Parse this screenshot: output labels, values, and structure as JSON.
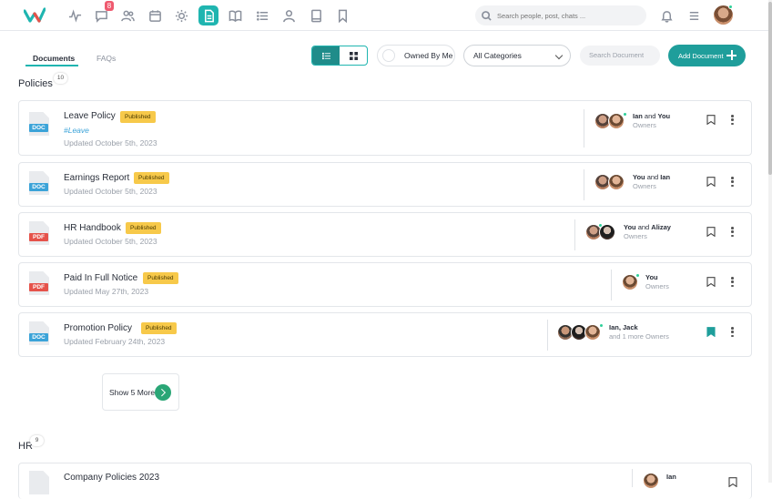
{
  "topbar": {
    "notification_count": "8",
    "search_placeholder": "Search people, post, chats ...",
    "nav_icons": [
      "activity-icon",
      "chat-icon",
      "people-icon",
      "calendar-icon",
      "sun-icon",
      "document-icon",
      "book-icon",
      "list-icon",
      "user-icon",
      "notebook-icon",
      "bookmark-icon"
    ],
    "active_icon": "document-icon",
    "accent_color": "#1fb5b0"
  },
  "tabs": [
    {
      "label": "Documents",
      "active": true
    },
    {
      "label": "FAQs",
      "active": false
    }
  ],
  "toolbar": {
    "owned_by_me": "Owned By Me",
    "category_selected": "All Categories",
    "search_placeholder": "Search Document",
    "add_document": "Add Document"
  },
  "sections": [
    {
      "title": "Policies",
      "count": "10",
      "documents": [
        {
          "title": "Leave Policy",
          "status": "Published",
          "type": "DOC",
          "tag": "#Leave",
          "updated": "Updated October 5th, 2023",
          "owner_a": "Ian",
          "owner_join": " and ",
          "owner_b": "You",
          "owner_sub": "Owners",
          "bookmarked": false
        },
        {
          "title": "Earnings Report",
          "status": "Published",
          "type": "DOC",
          "updated": "Updated October 5th, 2023",
          "owner_a": "You",
          "owner_join": " and ",
          "owner_b": "Ian",
          "owner_sub": "Owners",
          "bookmarked": false
        },
        {
          "title": "HR Handbook",
          "status": "Published",
          "type": "PDF",
          "updated": "Updated October 5th, 2023",
          "owner_a": "You",
          "owner_join": " and ",
          "owner_b": "Alizay",
          "owner_sub": "Owners",
          "bookmarked": false
        },
        {
          "title": "Paid In Full Notice",
          "status": "Published",
          "type": "PDF",
          "updated": "Updated May 27th, 2023",
          "owner_a": "You",
          "owner_join": "",
          "owner_b": "",
          "owner_sub": "Owners",
          "bookmarked": false
        },
        {
          "title": "Promotion Policy",
          "status": "Published",
          "type": "DOC",
          "updated": "Updated February 24th, 2023",
          "owner_a": "Ian, Jack",
          "owner_join": "",
          "owner_b": "",
          "owner_sub": "and 1 more Owners",
          "bookmarked": true
        }
      ],
      "show_more": "Show 5 More"
    },
    {
      "title": "HR",
      "count": "9",
      "documents": [
        {
          "title": "Company Policies 2023",
          "owner_a": "Ian"
        }
      ]
    }
  ]
}
